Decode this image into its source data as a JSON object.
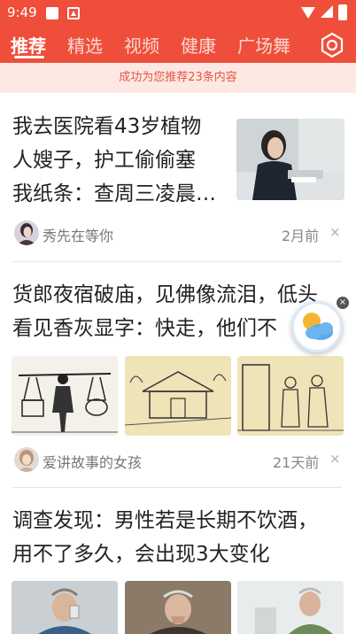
{
  "status_bar": {
    "time": "9:49"
  },
  "tabs": [
    {
      "label": "推荐"
    },
    {
      "label": "精选"
    },
    {
      "label": "视频"
    },
    {
      "label": "健康"
    },
    {
      "label": "广场舞"
    }
  ],
  "banner": {
    "text": "成功为您推荐23条内容"
  },
  "articles": [
    {
      "title_lines": [
        "我去医院看43岁植物",
        "人嫂子，护工偷偷塞",
        "我纸条：查周三凌晨…"
      ],
      "author": "秀先在等你",
      "time": "2月前"
    },
    {
      "title_lines": [
        "货郎夜宿破庙，见佛像流泪，低头",
        "看见香灰显字：快走，他们不"
      ],
      "author": "爱讲故事的女孩",
      "time": "21天前"
    },
    {
      "title_lines": [
        "调查发现：男性若是长期不饮酒，",
        "用不了多久，会出现3大变化"
      ]
    }
  ],
  "icons": {
    "gear": "settings-icon",
    "dismiss": "×",
    "float_close": "×"
  },
  "colors": {
    "accent": "#ef4e3a",
    "banner_bg": "#fde8e4",
    "banner_text": "#e5563f"
  }
}
